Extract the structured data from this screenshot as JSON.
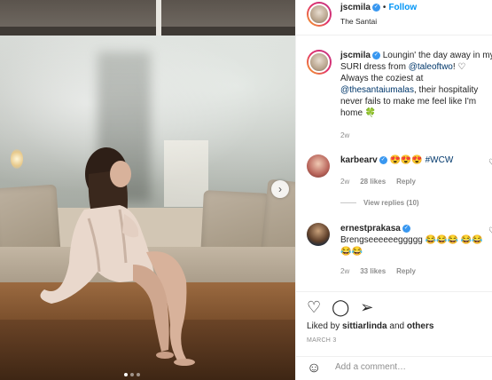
{
  "post": {
    "username": "jscmila",
    "separator": "•",
    "follow_label": "Follow",
    "location": "The Santai",
    "caption_text_1": "Loungin' the day away in my SURI dress from ",
    "caption_tag_1": "@taleoftwo",
    "caption_text_2": "! ♡ Always the coziest at ",
    "caption_tag_2": "@thesantaiumalas",
    "caption_text_3": ", their hospitality never fails to make me feel like I'm home 🍀",
    "caption_time": "2w"
  },
  "comments": [
    {
      "username": "karbearv",
      "text": "😍😍😍 ",
      "hashtag": "#WCW",
      "time": "2w",
      "likes": "28 likes",
      "reply_label": "Reply",
      "view_replies": "View replies (10)"
    },
    {
      "username": "ernestprakasa",
      "text": "Brengseeeeeeggggg 😂😂😂 😂😂😂😂",
      "time": "2w",
      "likes": "33 likes",
      "reply_label": "Reply"
    }
  ],
  "footer": {
    "liked_prefix": "Liked by ",
    "liked_user": "sittiarlinda",
    "liked_and": " and ",
    "liked_others": "others",
    "date": "MARCH 3",
    "comment_placeholder": "Add a comment…"
  },
  "icons": {
    "heart": "heart-icon",
    "comment": "comment-icon",
    "share": "share-icon",
    "emoji": "emoji-icon",
    "next": "chevron-right-icon"
  },
  "colors": {
    "link": "#00376b",
    "follow": "#0095f6",
    "verified": "#3897f0",
    "muted": "#8e8e8e"
  },
  "carousel": {
    "slides": 3,
    "active": 1
  }
}
